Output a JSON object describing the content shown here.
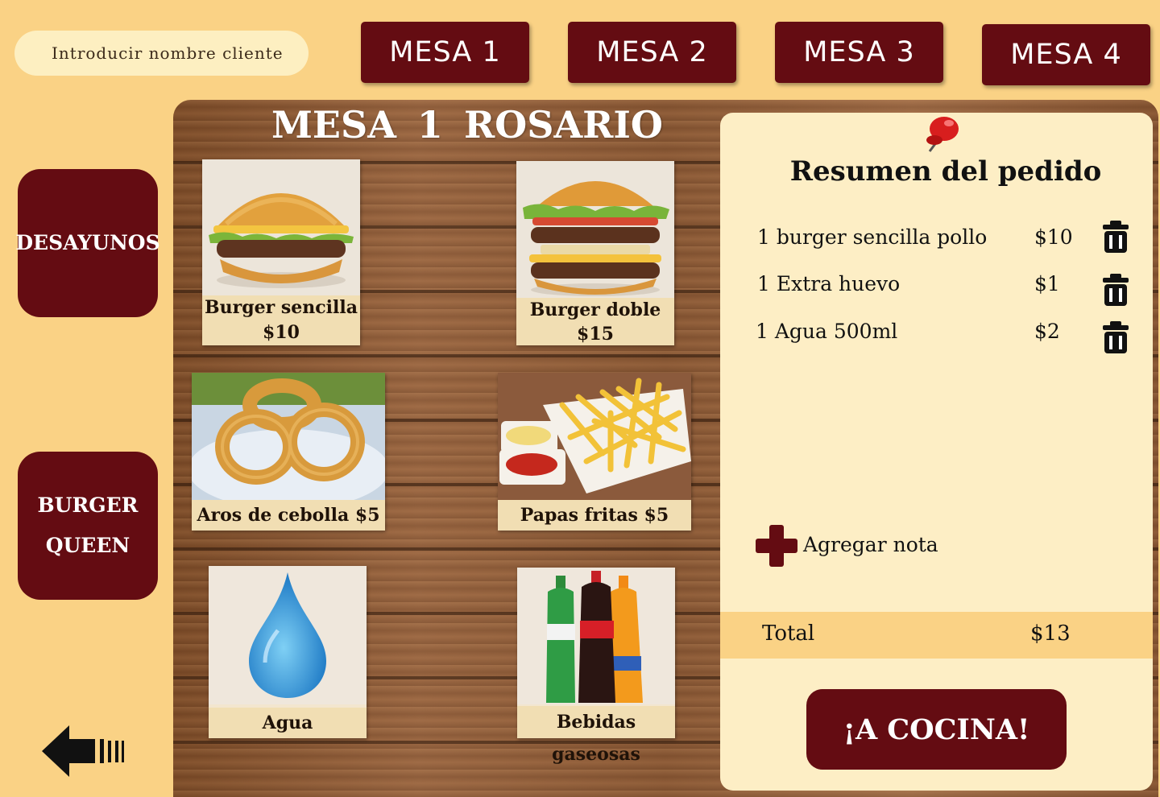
{
  "header": {
    "client_placeholder": "Introducir nombre cliente",
    "tables": [
      "MESA 1",
      "MESA 2",
      "MESA 3",
      "MESA 4"
    ]
  },
  "sidebar": {
    "categories": [
      "DESAYUNOS",
      "BURGER\nQUEEN"
    ],
    "back_icon": "back-arrow-icon"
  },
  "menu": {
    "title": "MESA 1  ROSARIO",
    "items": [
      {
        "name": "Burger sencilla",
        "price": "$10",
        "icon": "burger-sencilla-image"
      },
      {
        "name": "Burger doble",
        "price": "$15",
        "icon": "burger-doble-image"
      },
      {
        "label": "Aros de cebolla  $5",
        "icon": "onion-rings-image"
      },
      {
        "label": "Papas fritas  $5",
        "icon": "french-fries-image"
      },
      {
        "label": "Agua",
        "icon": "water-drop-image"
      },
      {
        "label": "Bebidas gaseosas",
        "icon": "soda-bottles-image"
      }
    ]
  },
  "summary": {
    "title": "Resumen del pedido",
    "items": [
      {
        "name": "1 burger sencilla pollo",
        "price": "$10"
      },
      {
        "name": "1 Extra huevo",
        "price": "$1"
      },
      {
        "name": "1 Agua 500ml",
        "price": "$2"
      }
    ],
    "add_note": "Agregar nota",
    "total_label": "Total",
    "total_value": "$13",
    "send_button": "¡A COCINA!"
  },
  "colors": {
    "background": "#fad285",
    "accent": "#640c12",
    "panel": "#fdeec5"
  }
}
